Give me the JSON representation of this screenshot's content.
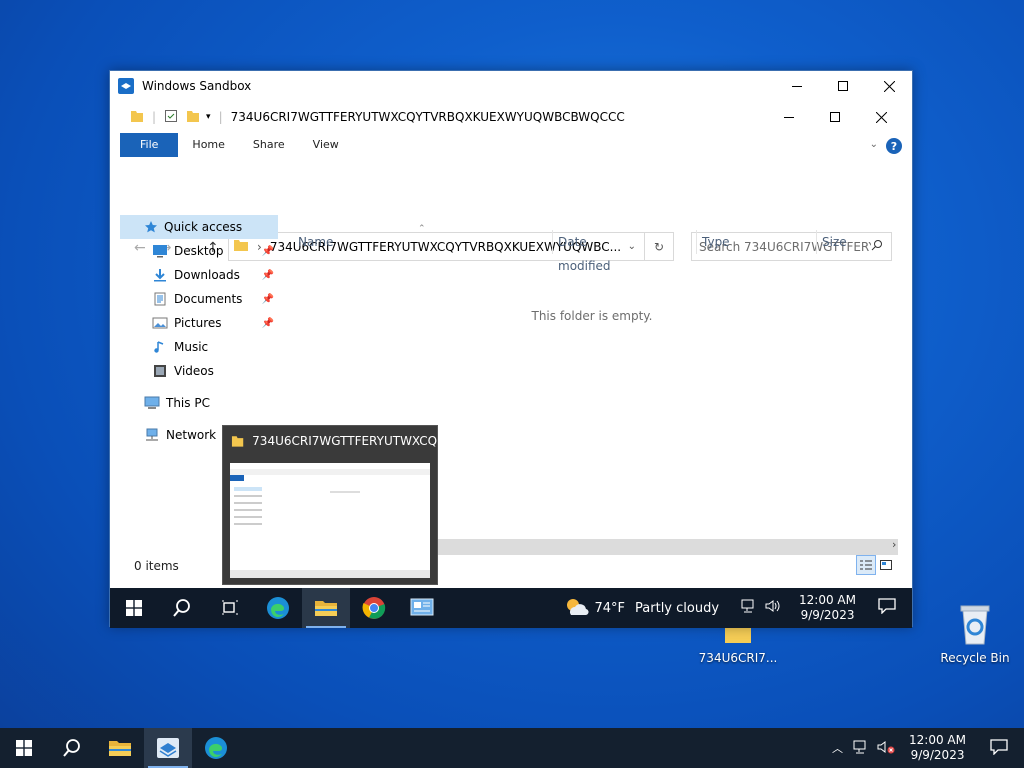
{
  "desktop": {
    "folder_label": "734U6CRI7...",
    "recycle_label": "Recycle Bin"
  },
  "sandbox": {
    "title": "Windows Sandbox",
    "explorer": {
      "folder_path": "734U6CRI7WGTTFERYUTWXCQYTVRBQXKUEXWYUQWBCBWQCCC",
      "ribbon_tabs": [
        "File",
        "Home",
        "Share",
        "View"
      ],
      "address_text": "734U6CRI7WGTTFERYUTWXCQYTVRBQXKUEXWYUQWBC...",
      "search_placeholder": "Search 734U6CRI7WGTTFERY...",
      "nav": {
        "quick_access": "Quick access",
        "items": [
          "Desktop",
          "Downloads",
          "Documents",
          "Pictures",
          "Music",
          "Videos"
        ],
        "this_pc": "This PC",
        "network": "Network"
      },
      "columns": [
        "Name",
        "Date modified",
        "Type",
        "Size"
      ],
      "empty_message": "This folder is empty.",
      "status": "0 items"
    },
    "preview_title": "734U6CRI7WGTTFERYUTWXCQ...",
    "inner_taskbar": {
      "weather_temp": "74°F",
      "weather_desc": "Partly cloudy",
      "time": "12:00 AM",
      "date": "9/9/2023"
    }
  },
  "host_taskbar": {
    "time": "12:00 AM",
    "date": "9/9/2023"
  },
  "colors": {
    "accent": "#1a63b8",
    "taskbar": "#14202f",
    "folder": "#f3c64e"
  }
}
